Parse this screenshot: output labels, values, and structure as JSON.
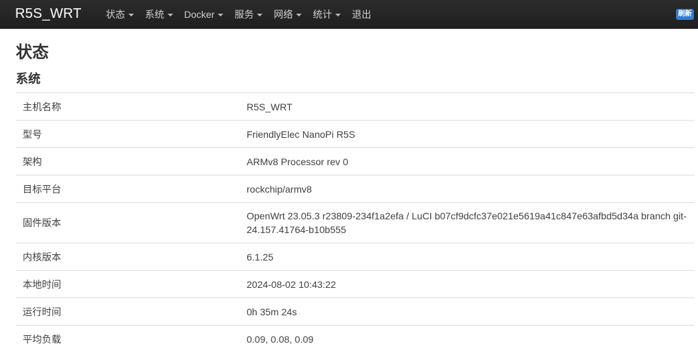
{
  "navbar": {
    "brand": "R5S_WRT",
    "menu": [
      {
        "label": "状态",
        "has_dropdown": true
      },
      {
        "label": "系统",
        "has_dropdown": true
      },
      {
        "label": "Docker",
        "has_dropdown": true
      },
      {
        "label": "服务",
        "has_dropdown": true
      },
      {
        "label": "网络",
        "has_dropdown": true
      },
      {
        "label": "统计",
        "has_dropdown": true
      },
      {
        "label": "退出",
        "has_dropdown": false
      }
    ],
    "refresh_label": "刷新",
    "accent_color": "#2f7fd6"
  },
  "page": {
    "title": "状态",
    "section_title": "系统"
  },
  "system_info": [
    {
      "key": "主机名称",
      "value": "R5S_WRT"
    },
    {
      "key": "型号",
      "value": "FriendlyElec NanoPi R5S"
    },
    {
      "key": "架构",
      "value": "ARMv8 Processor rev 0"
    },
    {
      "key": "目标平台",
      "value": "rockchip/armv8"
    },
    {
      "key": "固件版本",
      "value": "OpenWrt 23.05.3 r23809-234f1a2efa / LuCI b07cf9dcfc37e021e5619a41c847e63afbd5d34a branch git-24.157.41764-b10b555"
    },
    {
      "key": "内核版本",
      "value": "6.1.25"
    },
    {
      "key": "本地时间",
      "value": "2024-08-02 10:43:22"
    },
    {
      "key": "运行时间",
      "value": "0h 35m 24s"
    },
    {
      "key": "平均负载",
      "value": "0.09, 0.08, 0.09"
    }
  ]
}
